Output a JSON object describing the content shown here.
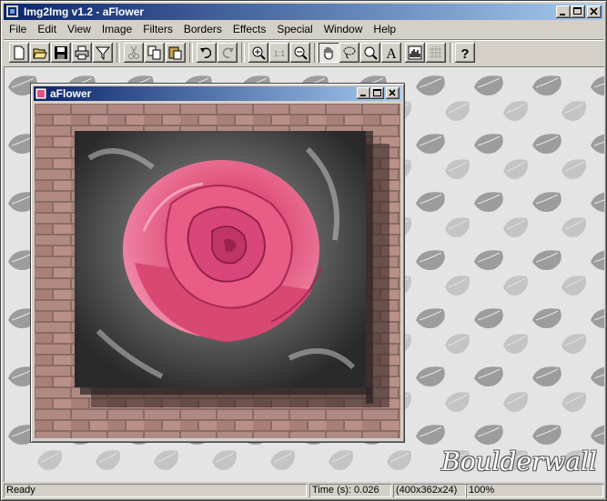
{
  "app": {
    "title": "Img2Img v1.2 - aFlower"
  },
  "menu": [
    "File",
    "Edit",
    "View",
    "Image",
    "Filters",
    "Borders",
    "Effects",
    "Special",
    "Window",
    "Help"
  ],
  "toolbar": {
    "buttons": [
      {
        "name": "new-icon"
      },
      {
        "name": "open-icon"
      },
      {
        "name": "save-icon"
      },
      {
        "name": "print-icon"
      },
      {
        "name": "funnel-icon"
      },
      {
        "name": "cut-icon"
      },
      {
        "name": "copy-icon"
      },
      {
        "name": "paste-icon"
      },
      {
        "name": "undo-icon"
      },
      {
        "name": "redo-icon"
      },
      {
        "name": "zoom-in-icon"
      },
      {
        "name": "actual-size-icon"
      },
      {
        "name": "zoom-out-icon"
      },
      {
        "name": "hand-icon"
      },
      {
        "name": "lasso-icon"
      },
      {
        "name": "magnifier-icon"
      },
      {
        "name": "text-icon"
      },
      {
        "name": "histogram-icon"
      },
      {
        "name": "grid-icon"
      },
      {
        "name": "help-icon"
      }
    ],
    "actual_size_label": "1:1",
    "text_tool_label": "A",
    "help_label": "?"
  },
  "document": {
    "title": "aFlower"
  },
  "workspace": {
    "watermark": "Boulderwall"
  },
  "status": {
    "message": "Ready",
    "time": "Time (s): 0.026",
    "dimensions": "(400x362x24)",
    "zoom": "100%"
  },
  "colors": {
    "titlebar_start": "#0a246a",
    "titlebar_end": "#a6caf0",
    "rose": "#e0507a",
    "brick": "#a88078"
  }
}
